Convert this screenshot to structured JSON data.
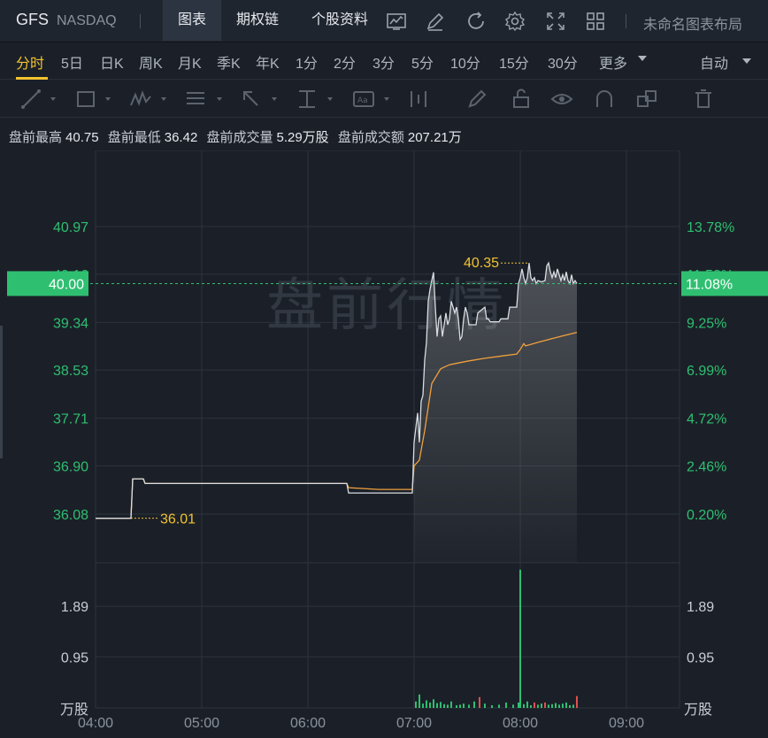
{
  "header": {
    "ticker": "GFS",
    "exchange": "NASDAQ",
    "tabs": [
      {
        "label": "图表",
        "active": true
      },
      {
        "label": "期权链",
        "active": false
      },
      {
        "label": "个股资料",
        "active": false
      }
    ],
    "layout_name": "未命名图表布局"
  },
  "periods": {
    "items": [
      "分时",
      "5日",
      "日K",
      "周K",
      "月K",
      "季K",
      "年K",
      "1分",
      "2分",
      "3分",
      "5分",
      "10分",
      "15分",
      "30分",
      "更多"
    ],
    "active": "分时",
    "scale_mode": "自动"
  },
  "stats": {
    "high_label": "盘前最高",
    "high": "40.75",
    "low_label": "盘前最低",
    "low": "36.42",
    "volume_label": "盘前成交量",
    "volume": "5.29万股",
    "turnover_label": "盘前成交额",
    "turnover": "207.21万"
  },
  "chart_data": {
    "type": "line",
    "watermark": "盘前行情",
    "price_axis": {
      "ticks": [
        "40.97",
        "40.16",
        "39.34",
        "38.53",
        "37.71",
        "36.90",
        "36.08"
      ],
      "tick_values": [
        40.97,
        40.16,
        39.34,
        38.53,
        37.71,
        36.9,
        36.08
      ],
      "pct_ticks": [
        "13.78%",
        "11.53%",
        "9.25%",
        "6.99%",
        "4.72%",
        "2.46%",
        "0.20%"
      ],
      "current_price": "40.00",
      "current_pct": "11.08%",
      "current_value": 40.0
    },
    "volume_axis": {
      "ticks": [
        "1.89",
        "0.95"
      ],
      "tick_values": [
        1.89,
        0.95
      ],
      "unit": "万股",
      "max": 2.6
    },
    "x_axis": {
      "labels": [
        "04:00",
        "05:00",
        "06:00",
        "07:00",
        "08:00",
        "09:00"
      ],
      "start": "04:00",
      "end": "09:30"
    },
    "annotations": {
      "high_label": "40.35",
      "high_value": 40.35,
      "high_time": "08:05",
      "low_label": "36.01",
      "low_value": 36.01,
      "low_time": "04:20"
    },
    "series": [
      {
        "role": "price",
        "color": "#d9dde3",
        "points": [
          [
            "04:00",
            36.01
          ],
          [
            "04:20",
            36.01
          ],
          [
            "04:21",
            36.68
          ],
          [
            "04:27",
            36.68
          ],
          [
            "04:28",
            36.6
          ],
          [
            "06:22",
            36.6
          ],
          [
            "06:23",
            36.44
          ],
          [
            "06:59",
            36.44
          ],
          [
            "07:00",
            37.3
          ],
          [
            "07:02",
            37.8
          ],
          [
            "07:03",
            37.3
          ],
          [
            "07:04",
            38.0
          ],
          [
            "07:05",
            38.1
          ],
          [
            "07:06",
            38.7
          ],
          [
            "07:07",
            39.0
          ],
          [
            "07:08",
            39.7
          ],
          [
            "07:09",
            39.9
          ],
          [
            "07:10",
            40.05
          ],
          [
            "07:11",
            40.19
          ],
          [
            "07:12",
            39.6
          ],
          [
            "07:13",
            39.1
          ],
          [
            "07:14",
            39.4
          ],
          [
            "07:15",
            39.45
          ],
          [
            "07:16",
            39.1
          ],
          [
            "07:17",
            39.3
          ],
          [
            "07:18",
            39.5
          ],
          [
            "07:19",
            39.3
          ],
          [
            "07:20",
            39.4
          ],
          [
            "07:21",
            39.7
          ],
          [
            "07:22",
            39.6
          ],
          [
            "07:23",
            39.5
          ],
          [
            "07:24",
            39.6
          ],
          [
            "07:25",
            39.4
          ],
          [
            "07:26",
            39.05
          ],
          [
            "07:27",
            39.1
          ],
          [
            "07:28",
            39.4
          ],
          [
            "07:29",
            39.6
          ],
          [
            "07:30",
            39.5
          ],
          [
            "07:31",
            39.3
          ],
          [
            "07:35",
            39.3
          ],
          [
            "07:36",
            39.5
          ],
          [
            "07:40",
            39.6
          ],
          [
            "07:41",
            39.4
          ],
          [
            "07:42",
            39.4
          ],
          [
            "07:43",
            39.35
          ],
          [
            "07:48",
            39.35
          ],
          [
            "07:49",
            39.4
          ],
          [
            "07:53",
            39.4
          ],
          [
            "07:54",
            39.6
          ],
          [
            "07:58",
            39.6
          ],
          [
            "07:59",
            40.0
          ],
          [
            "08:00",
            40.1
          ],
          [
            "08:01",
            40.25
          ],
          [
            "08:02",
            40.1
          ],
          [
            "08:03",
            40.0
          ],
          [
            "08:04",
            40.1
          ],
          [
            "08:05",
            40.35
          ],
          [
            "08:06",
            40.1
          ],
          [
            "08:07",
            40.05
          ],
          [
            "08:08",
            40.1
          ],
          [
            "08:09",
            40.0
          ],
          [
            "08:10",
            40.05
          ],
          [
            "08:12",
            40.03
          ],
          [
            "08:14",
            40.05
          ],
          [
            "08:15",
            40.3
          ],
          [
            "08:16",
            40.35
          ],
          [
            "08:17",
            40.2
          ],
          [
            "08:18",
            40.1
          ],
          [
            "08:19",
            40.2
          ],
          [
            "08:20",
            40.1
          ],
          [
            "08:21",
            40.25
          ],
          [
            "08:22",
            40.15
          ],
          [
            "08:23",
            40.05
          ],
          [
            "08:24",
            40.15
          ],
          [
            "08:25",
            40.05
          ],
          [
            "08:26",
            40.2
          ],
          [
            "08:27",
            40.05
          ],
          [
            "08:28",
            40.0
          ],
          [
            "08:29",
            40.15
          ],
          [
            "08:30",
            40.0
          ],
          [
            "08:31",
            40.05
          ],
          [
            "08:32",
            40.0
          ]
        ]
      },
      {
        "role": "average",
        "color": "#f0a03c",
        "points": [
          [
            "04:00",
            36.01
          ],
          [
            "04:20",
            36.01
          ],
          [
            "04:21",
            36.68
          ],
          [
            "04:27",
            36.68
          ],
          [
            "04:28",
            36.6
          ],
          [
            "06:22",
            36.6
          ],
          [
            "06:23",
            36.53
          ],
          [
            "06:40",
            36.5
          ],
          [
            "06:59",
            36.5
          ],
          [
            "07:00",
            36.9
          ],
          [
            "07:03",
            37.0
          ],
          [
            "07:06",
            37.5
          ],
          [
            "07:08",
            37.9
          ],
          [
            "07:10",
            38.3
          ],
          [
            "07:12",
            38.4
          ],
          [
            "07:15",
            38.55
          ],
          [
            "07:20",
            38.62
          ],
          [
            "07:30",
            38.68
          ],
          [
            "07:40",
            38.73
          ],
          [
            "07:50",
            38.77
          ],
          [
            "07:58",
            38.8
          ],
          [
            "08:00",
            38.88
          ],
          [
            "08:02",
            38.98
          ],
          [
            "08:03",
            38.94
          ],
          [
            "08:10",
            39.0
          ],
          [
            "08:20",
            39.08
          ],
          [
            "08:28",
            39.14
          ],
          [
            "08:32",
            39.17
          ]
        ]
      }
    ],
    "volume": {
      "color_up": "#2fbf71",
      "color_down": "#e0504c",
      "bars": [
        [
          "07:01",
          0.12,
          "up"
        ],
        [
          "07:03",
          0.25,
          "up"
        ],
        [
          "07:05",
          0.08,
          "up"
        ],
        [
          "07:07",
          0.14,
          "up"
        ],
        [
          "07:09",
          0.1,
          "up"
        ],
        [
          "07:11",
          0.16,
          "up"
        ],
        [
          "07:13",
          0.09,
          "up"
        ],
        [
          "07:15",
          0.11,
          "up"
        ],
        [
          "07:17",
          0.07,
          "up"
        ],
        [
          "07:19",
          0.06,
          "up"
        ],
        [
          "07:21",
          0.12,
          "up"
        ],
        [
          "07:24",
          0.05,
          "up"
        ],
        [
          "07:26",
          0.06,
          "up"
        ],
        [
          "07:28",
          0.08,
          "up"
        ],
        [
          "07:31",
          0.06,
          "up"
        ],
        [
          "07:34",
          0.12,
          "up"
        ],
        [
          "07:37",
          0.2,
          "down"
        ],
        [
          "07:40",
          0.08,
          "up"
        ],
        [
          "07:44",
          0.05,
          "up"
        ],
        [
          "07:48",
          0.06,
          "up"
        ],
        [
          "07:52",
          0.1,
          "up"
        ],
        [
          "07:56",
          0.06,
          "up"
        ],
        [
          "07:59",
          0.1,
          "up"
        ],
        [
          "08:00",
          2.57,
          "up"
        ],
        [
          "08:02",
          0.07,
          "up"
        ],
        [
          "08:04",
          0.12,
          "up"
        ],
        [
          "08:06",
          0.05,
          "up"
        ],
        [
          "08:08",
          0.1,
          "down"
        ],
        [
          "08:10",
          0.06,
          "up"
        ],
        [
          "08:12",
          0.08,
          "up"
        ],
        [
          "08:14",
          0.1,
          "down"
        ],
        [
          "08:16",
          0.06,
          "up"
        ],
        [
          "08:18",
          0.07,
          "up"
        ],
        [
          "08:20",
          0.09,
          "up"
        ],
        [
          "08:22",
          0.06,
          "up"
        ],
        [
          "08:24",
          0.08,
          "up"
        ],
        [
          "08:26",
          0.1,
          "up"
        ],
        [
          "08:28",
          0.05,
          "up"
        ],
        [
          "08:30",
          0.06,
          "up"
        ],
        [
          "08:32",
          0.22,
          "down"
        ]
      ]
    }
  }
}
